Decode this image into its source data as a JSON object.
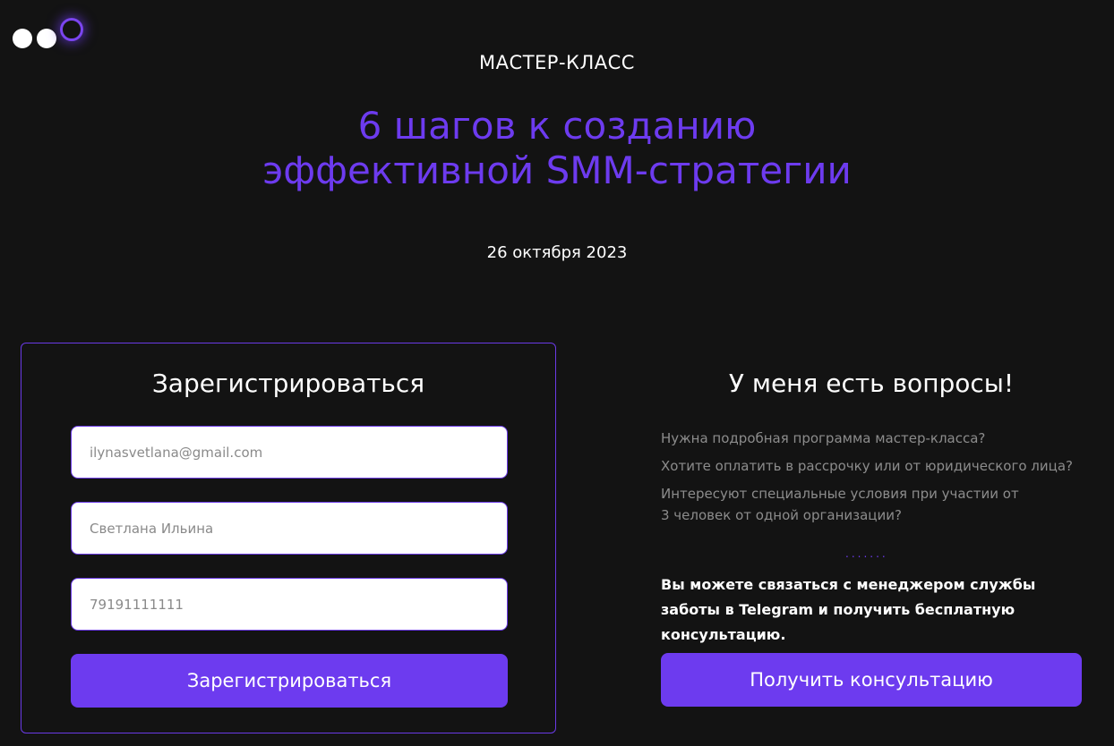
{
  "brand": {
    "logo_dots": [
      "white",
      "white",
      "violet-ring"
    ],
    "accent_color": "#6d3bef",
    "background_color": "#131313"
  },
  "hero": {
    "eyebrow": "МАСТЕР-КЛАСС",
    "headline_line1": "6 шагов к созданию",
    "headline_line2": "эффективной SMM-стратегии",
    "date": "26 октября 2023"
  },
  "register_form": {
    "title": "Зарегистрироваться",
    "fields": [
      {
        "placeholder": "ilynasvetlana@gmail.com"
      },
      {
        "placeholder": "Светлана Ильина"
      },
      {
        "placeholder": "79191111111"
      }
    ],
    "submit_label": "Зарегистрироваться"
  },
  "questions": {
    "title": "У меня есть вопросы!",
    "items": [
      "Нужна подробная программа мастер-класса?",
      "Хотите оплатить в рассрочку или от юридического лица?",
      "Интересуют специальные условия при участии от 3 человек от одной организации?"
    ],
    "separator": ".......",
    "contact_text": "Вы можете связаться с менеджером службы заботы в Telegram и получить бесплатную консультацию.",
    "button_label": "Получить консультацию"
  }
}
